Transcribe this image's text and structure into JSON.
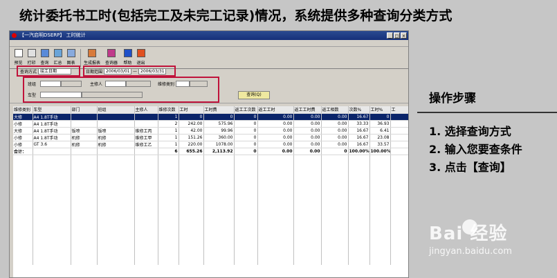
{
  "headline": "统计委托书工时(包括完工及未完工记录)情况，系统提供多种查询分类方式",
  "window": {
    "title": "【一汽启明DSERP】  工时统计",
    "buttons": [
      "_",
      "□",
      "×"
    ]
  },
  "toolbar": [
    {
      "label": "预览",
      "icon": "preview-icon",
      "color": "#ffffff"
    },
    {
      "label": "打印",
      "icon": "print-icon",
      "color": "#e0e0e0"
    },
    {
      "label": "查询",
      "icon": "query-icon",
      "color": "#5a8ad8"
    },
    {
      "label": "汇总",
      "icon": "summary-icon",
      "color": "#6aa4d8"
    },
    {
      "label": "图表",
      "icon": "chart-icon",
      "color": "#88aadd"
    },
    {
      "label": "生成报表",
      "icon": "report-icon",
      "color": "#d87a3a"
    },
    {
      "label": "查询器",
      "icon": "querier-icon",
      "color": "#c03a8a"
    },
    {
      "label": "帮助",
      "icon": "help-icon",
      "color": "#1f50c8"
    },
    {
      "label": "退出",
      "icon": "exit-icon",
      "color": "#e05020"
    }
  ],
  "search": {
    "mode_label": "查询方式",
    "mode_value": "竣工日期",
    "date_label": "日期范围",
    "date_from": "2006/03/01",
    "date_sep": "—",
    "date_to": "2006/03/31",
    "team_label": "班组",
    "owner_label": "主修人",
    "repair_type_label": "维修类别",
    "car_label": "车型",
    "query_button": "查询(Q)"
  },
  "table": {
    "headers": [
      "维修类别",
      "车型",
      "部门",
      "班组",
      "主修人",
      "维修次数",
      "工时",
      "工时费",
      "返工工次数",
      "返工工时",
      "返工工时费",
      "返工相数",
      "次数%",
      "工时%",
      "工"
    ],
    "rows": [
      [
        "大修",
        "A4 1.8T手动",
        "",
        "",
        "",
        "1",
        "0",
        "0",
        "0",
        "0.00",
        "0.00",
        "0.00",
        "16.67",
        "0",
        ""
      ],
      [
        "小修",
        "A4 1.8T手动",
        "",
        "",
        "",
        "2",
        "242.00",
        "575.96",
        "0",
        "0.00",
        "0.00",
        "0.00",
        "33.33",
        "36.93",
        ""
      ],
      [
        "大修",
        "A4 1.8T手动",
        "钣喷",
        "钣喷",
        "维修工丙",
        "1",
        "42.00",
        "99.96",
        "0",
        "0.00",
        "0.00",
        "0.00",
        "16.67",
        "6.41",
        ""
      ],
      [
        "小修",
        "A4 1.8T手动",
        "机修",
        "机修",
        "维修工甲",
        "1",
        "151.26",
        "360.00",
        "0",
        "0.00",
        "0.00",
        "0.00",
        "16.67",
        "23.08",
        ""
      ],
      [
        "小修",
        "GT 3.6",
        "机修",
        "机修",
        "维修工乙",
        "1",
        "220.00",
        "1078.00",
        "0",
        "0.00",
        "0.00",
        "0.00",
        "16.67",
        "33.57",
        ""
      ],
      [
        "合计：",
        "",
        "",
        "",
        "",
        "6",
        "655.26",
        "2,113.92",
        "0",
        "0.00",
        "0.00",
        "0",
        "100.00%",
        "100.00%",
        ""
      ]
    ]
  },
  "steps": {
    "title": "操作步骤",
    "items": [
      "1. 选择查询方式",
      "2. 输入您要查条件",
      "3. 点击【查询】"
    ]
  },
  "watermark": {
    "brand": "Bai 经验",
    "url": "jingyan.baidu.com"
  }
}
